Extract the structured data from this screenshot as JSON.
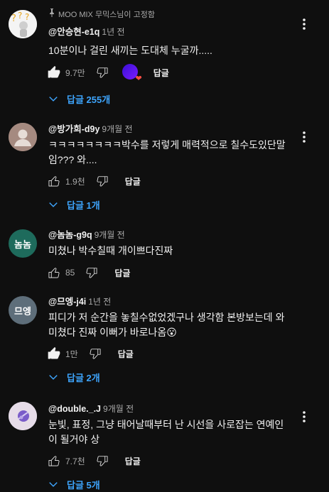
{
  "comments": [
    {
      "pinned_label": "MOO MIX 무믹스님이 고정함",
      "author": "@안승현-e1q",
      "time": "1년 전",
      "text": "10분이나 걸린 새끼는 도대체 누굴까.....",
      "likes": "9.7만",
      "reply_label": "답글",
      "replies_label": "답글 255개",
      "liked": true,
      "creator_heart": true,
      "avatar_type": "image",
      "avatar_bg": "#f4f4f4"
    },
    {
      "author": "@방가희-d9y",
      "time": "9개월 전",
      "text": "ㅋㅋㅋㅋㅋㅋㅋㅋ박수를 저렇게 매력적으로 칠수도있단말임??? 와....",
      "likes": "1.9천",
      "reply_label": "답글",
      "replies_label": "답글 1개",
      "liked": false,
      "avatar_type": "default",
      "avatar_bg": "#a58a80"
    },
    {
      "author": "@놈놈-g9q",
      "time": "9개월 전",
      "text": "미쳤나 박수칠때 개이쁘다진짜",
      "likes": "85",
      "reply_label": "답글",
      "liked": false,
      "avatar_type": "text",
      "avatar_text": "놈놈",
      "avatar_bg": "#1e6b5c"
    },
    {
      "author": "@므엥-j4i",
      "time": "1년 전",
      "text": "피디가 저 순간을 놓칠수없었겠구나 생각함 본방보는데 와 미쳤다 진짜 이뻐가 바로나옴😮",
      "likes": "1만",
      "reply_label": "답글",
      "replies_label": "답글 2개",
      "liked": true,
      "avatar_type": "text",
      "avatar_text": "므엥",
      "avatar_bg": "#5e6e7a"
    },
    {
      "author": "@double._.J",
      "time": "9개월 전",
      "text": "눈빛, 표정, 그냥 태어날때부터 난 시선을 사로잡는 연예인이 될거야 상",
      "likes": "7.7천",
      "reply_label": "답글",
      "replies_label": "답글 5개",
      "liked": false,
      "avatar_type": "image2",
      "avatar_bg": "#e6dce8"
    }
  ],
  "colors": {
    "background": "#0f0f0f",
    "text": "#f1f1f1",
    "secondary": "#aaaaaa",
    "link": "#3ea6ff"
  }
}
